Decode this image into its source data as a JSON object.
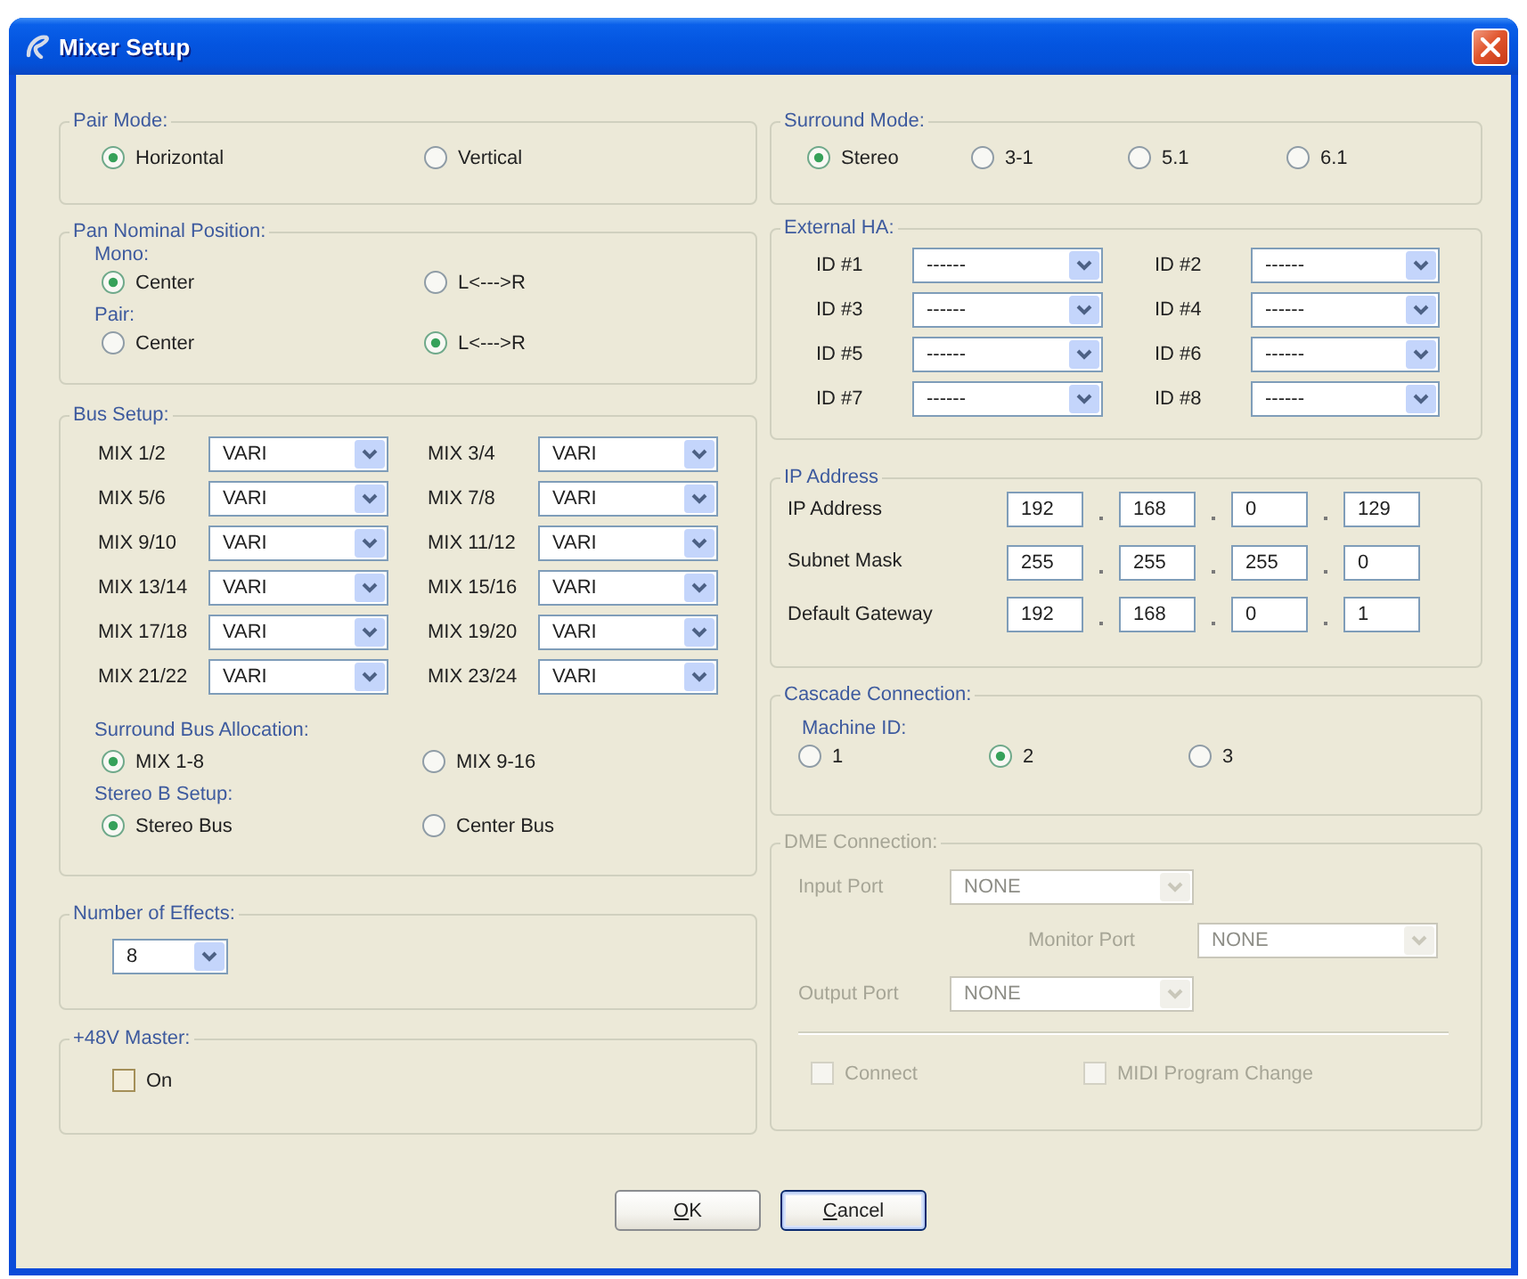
{
  "window": {
    "title": "Mixer Setup"
  },
  "pair_mode": {
    "label": "Pair Mode:",
    "options": [
      {
        "label": "Horizontal",
        "selected": true
      },
      {
        "label": "Vertical",
        "selected": false
      }
    ]
  },
  "pan_nominal_position": {
    "label": "Pan Nominal Position:",
    "groups": [
      {
        "label": "Mono:",
        "options": [
          {
            "label": "Center",
            "selected": true
          },
          {
            "label": "L<--->R",
            "selected": false
          }
        ]
      },
      {
        "label": "Pair:",
        "options": [
          {
            "label": "Center",
            "selected": false
          },
          {
            "label": "L<--->R",
            "selected": true
          }
        ]
      }
    ]
  },
  "bus_setup": {
    "label": "Bus Setup:",
    "buses": [
      {
        "label": "MIX 1/2",
        "value": "VARI"
      },
      {
        "label": "MIX 3/4",
        "value": "VARI"
      },
      {
        "label": "MIX 5/6",
        "value": "VARI"
      },
      {
        "label": "MIX 7/8",
        "value": "VARI"
      },
      {
        "label": "MIX 9/10",
        "value": "VARI"
      },
      {
        "label": "MIX 11/12",
        "value": "VARI"
      },
      {
        "label": "MIX 13/14",
        "value": "VARI"
      },
      {
        "label": "MIX 15/16",
        "value": "VARI"
      },
      {
        "label": "MIX 17/18",
        "value": "VARI"
      },
      {
        "label": "MIX 19/20",
        "value": "VARI"
      },
      {
        "label": "MIX 21/22",
        "value": "VARI"
      },
      {
        "label": "MIX 23/24",
        "value": "VARI"
      }
    ],
    "groups": [
      {
        "label": "Surround Bus Allocation:",
        "options": [
          {
            "label": "MIX 1-8",
            "selected": true
          },
          {
            "label": "MIX 9-16",
            "selected": false
          }
        ]
      },
      {
        "label": "Stereo B Setup:",
        "options": [
          {
            "label": "Stereo Bus",
            "selected": true
          },
          {
            "label": "Center Bus",
            "selected": false
          }
        ]
      }
    ]
  },
  "number_of_effects": {
    "label": "Number of Effects:",
    "value": "8"
  },
  "phantom_master": {
    "label": "+48V Master:",
    "checkbox": {
      "label": "On",
      "checked": false
    }
  },
  "surround_mode": {
    "label": "Surround Mode:",
    "options": [
      {
        "label": "Stereo",
        "selected": true
      },
      {
        "label": "3-1",
        "selected": false
      },
      {
        "label": "5.1",
        "selected": false
      },
      {
        "label": "6.1",
        "selected": false
      }
    ]
  },
  "external_ha": {
    "label": "External HA:",
    "slots": [
      {
        "label": "ID #1",
        "value": "------"
      },
      {
        "label": "ID #2",
        "value": "------"
      },
      {
        "label": "ID #3",
        "value": "------"
      },
      {
        "label": "ID #4",
        "value": "------"
      },
      {
        "label": "ID #5",
        "value": "------"
      },
      {
        "label": "ID #6",
        "value": "------"
      },
      {
        "label": "ID #7",
        "value": "------"
      },
      {
        "label": "ID #8",
        "value": "------"
      }
    ]
  },
  "ip_address": {
    "label": "IP Address",
    "rows": [
      {
        "label": "IP Address",
        "octets": [
          "192",
          "168",
          "0",
          "129"
        ]
      },
      {
        "label": "Subnet Mask",
        "octets": [
          "255",
          "255",
          "255",
          "0"
        ]
      },
      {
        "label": "Default Gateway",
        "octets": [
          "192",
          "168",
          "0",
          "1"
        ]
      }
    ]
  },
  "cascade_connection": {
    "label": "Cascade Connection:",
    "groups": [
      {
        "label": "Machine ID:",
        "options": [
          {
            "label": "1",
            "selected": false
          },
          {
            "label": "2",
            "selected": true
          },
          {
            "label": "3",
            "selected": false
          }
        ]
      }
    ]
  },
  "dme_connection": {
    "label": "DME Connection:",
    "disabled": true,
    "ports": [
      {
        "label": "Input Port",
        "value": "NONE"
      },
      {
        "label": "Monitor Port",
        "value": "NONE"
      },
      {
        "label": "Output Port",
        "value": "NONE"
      }
    ],
    "checkboxes": [
      {
        "label": "Connect",
        "checked": false
      },
      {
        "label": "MIDI Program Change",
        "checked": false
      }
    ]
  },
  "buttons": [
    {
      "label": "OK",
      "default": false,
      "mnemonic": true
    },
    {
      "label": "Cancel",
      "default": true,
      "mnemonic": true
    }
  ]
}
